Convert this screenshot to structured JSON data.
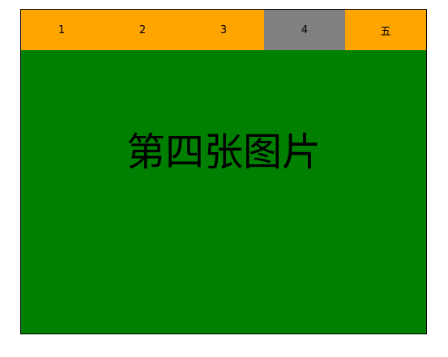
{
  "tabs": [
    {
      "label": "1",
      "active": false
    },
    {
      "label": "2",
      "active": false
    },
    {
      "label": "3",
      "active": false
    },
    {
      "label": "4",
      "active": true
    },
    {
      "label": "五",
      "active": false
    }
  ],
  "panel": {
    "text": "第四张图片"
  },
  "colors": {
    "tab_background": "#ffa500",
    "tab_active_background": "#808080",
    "panel_background": "#008000",
    "border": "#000000"
  }
}
